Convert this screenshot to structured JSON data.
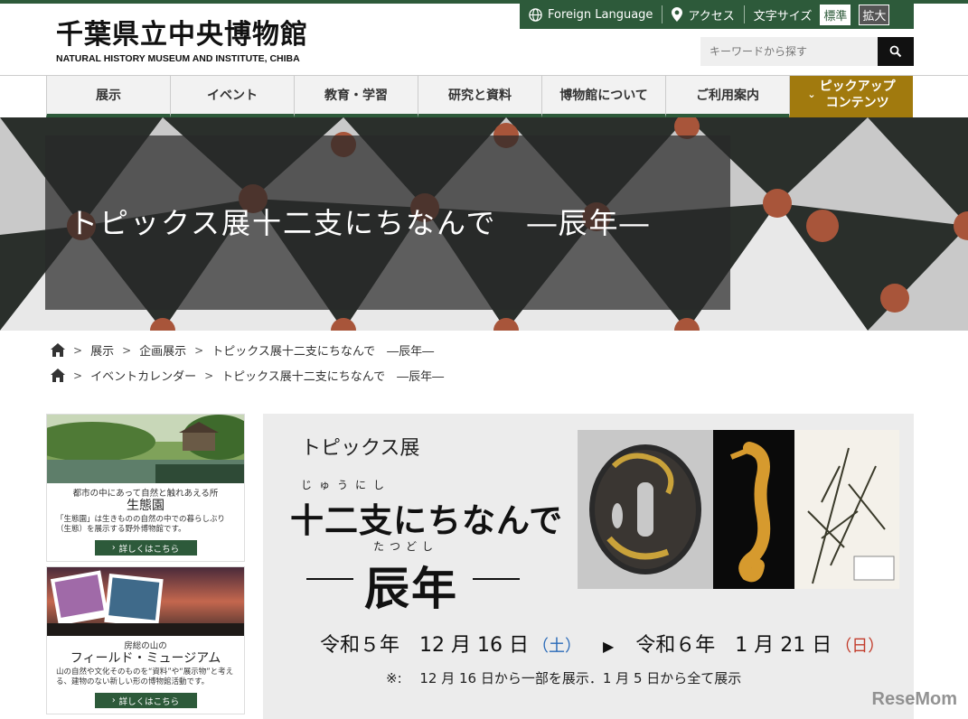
{
  "logo": {
    "jp": "千葉県立中央博物館",
    "en": "NATURAL HISTORY MUSEUM AND INSTITUTE, CHIBA"
  },
  "utility": {
    "language": "Foreign Language",
    "access": "アクセス",
    "text_size": "文字サイズ",
    "size_standard": "標準",
    "size_large": "拡大"
  },
  "search": {
    "placeholder": "キーワードから探す"
  },
  "nav": {
    "items": [
      "展示",
      "イベント",
      "教育・学習",
      "研究と資料",
      "博物館について",
      "ご利用案内"
    ],
    "pickup_line1": "ピックアップ",
    "pickup_line2": "コンテンツ"
  },
  "hero": {
    "title": "トピックス展十二支にちなんで　―辰年―"
  },
  "breadcrumb1": [
    "展示",
    "企画展示",
    "トピックス展十二支にちなんで　―辰年―"
  ],
  "breadcrumb2": [
    "イベントカレンダー",
    "トピックス展十二支にちなんで　―辰年―"
  ],
  "cards": [
    {
      "sub": "都市の中にあって自然と触れあえる所",
      "title": "生態園",
      "desc": "「生態園」は生きものの自然の中での暮らしぶり（生態）を展示する野外博物館です。",
      "more": "詳しくはこちら"
    },
    {
      "sub": "房総の山の",
      "title": "フィールド・ミュージアム",
      "desc": "山の自然や文化そのものを“資料”や“展示物”と考える、建物のない新しい形の博物館活動です。",
      "more": "詳しくはこちら"
    }
  ],
  "panel": {
    "topix": "トピックス展",
    "ruby1": "じゅうにし",
    "main": "十二支にちなんで",
    "ruby2": "たつどし",
    "tatsu": "辰年",
    "start": "令和５年　12 月 16 日",
    "start_dow": "（土）",
    "end": "令和６年　1 月 21 日",
    "end_dow": "（日）",
    "note": "※:　 12 月 16 日から一部を展示．1 月 5 日から全て展示"
  },
  "watermark": "ReseMom",
  "colors": {
    "green": "#2d5a3a",
    "gold": "#a17a0e",
    "panel": "#ececec"
  }
}
